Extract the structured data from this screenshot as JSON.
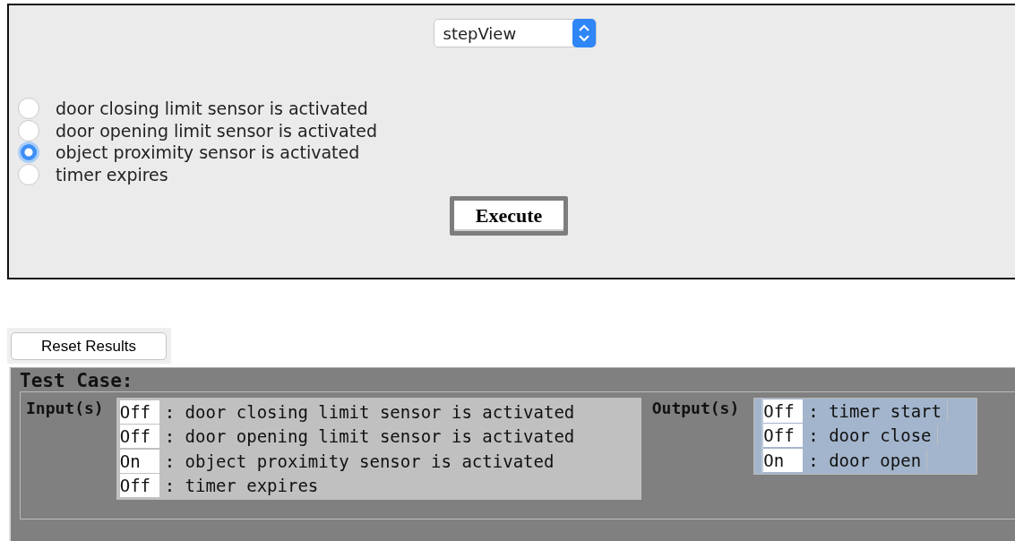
{
  "view_select": {
    "value": "stepView"
  },
  "events": [
    {
      "label": "door closing limit sensor is activated",
      "selected": false
    },
    {
      "label": "door opening limit sensor is activated",
      "selected": false
    },
    {
      "label": "object proximity sensor is activated",
      "selected": true
    },
    {
      "label": "timer expires",
      "selected": false
    }
  ],
  "execute_button": "Execute",
  "reset_button": "Reset Results",
  "test_case": {
    "title": "Test Case:",
    "inputs_label": "Input(s)",
    "outputs_label": "Output(s)",
    "inputs": [
      {
        "value": "Off",
        "name": ": door closing limit sensor is activated"
      },
      {
        "value": "Off",
        "name": ": door opening limit sensor is activated"
      },
      {
        "value": "On",
        "name": ": object proximity sensor is activated"
      },
      {
        "value": "Off",
        "name": ": timer expires"
      }
    ],
    "outputs": [
      {
        "value": "Off",
        "name": ": timer start"
      },
      {
        "value": "Off",
        "name": ": door close"
      },
      {
        "value": "On",
        "name": ": door open"
      }
    ]
  }
}
